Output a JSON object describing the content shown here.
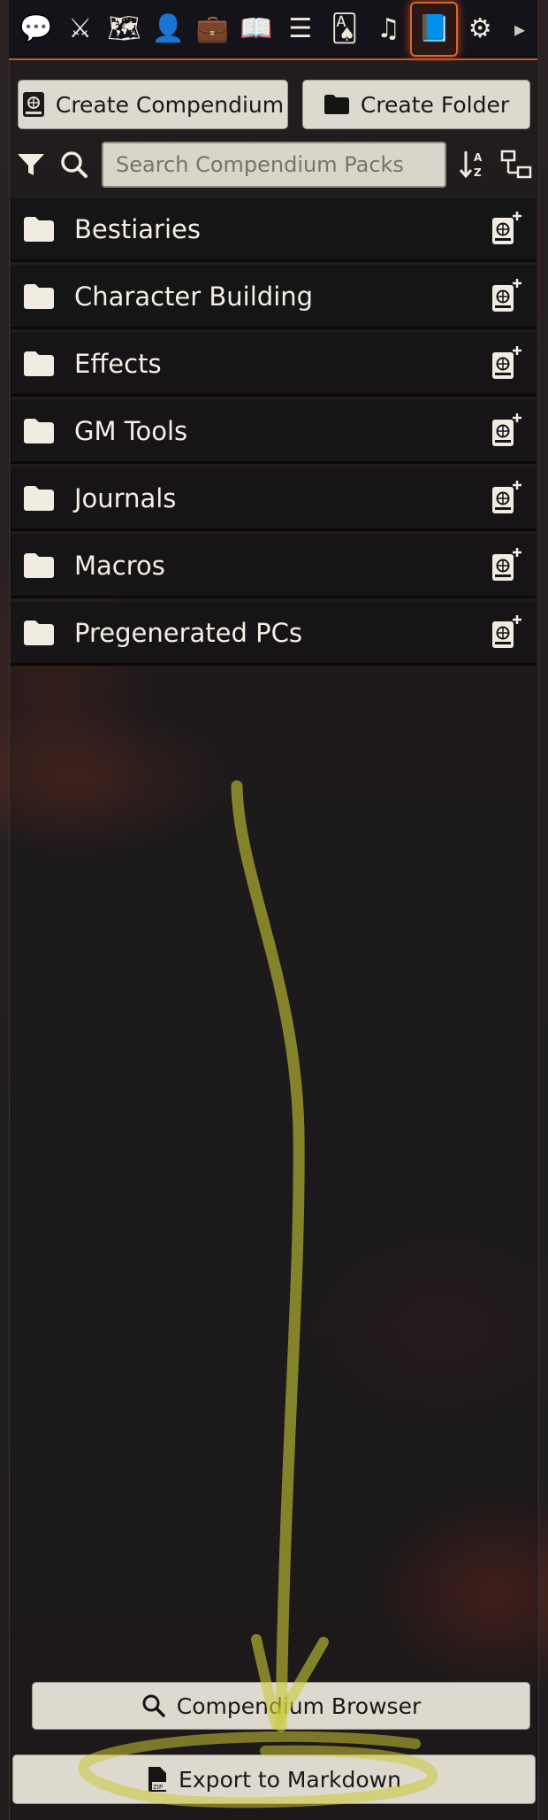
{
  "tabs": [
    {
      "name": "chat-icon",
      "glyph": "💬"
    },
    {
      "name": "combat-icon",
      "glyph": "⚔"
    },
    {
      "name": "scenes-map-icon",
      "glyph": "🗺"
    },
    {
      "name": "actors-user-icon",
      "glyph": "👤"
    },
    {
      "name": "items-suitcase-icon",
      "glyph": "💼"
    },
    {
      "name": "journal-book-icon",
      "glyph": "📖"
    },
    {
      "name": "tables-list-icon",
      "glyph": "☰"
    },
    {
      "name": "cards-icon",
      "glyph": "🂡"
    },
    {
      "name": "playlists-music-icon",
      "glyph": "♫"
    },
    {
      "name": "compendium-atlas-icon",
      "glyph": "📘",
      "active": true
    },
    {
      "name": "settings-cogs-icon",
      "glyph": "⚙"
    },
    {
      "name": "collapse-chevron-icon",
      "glyph": "▸"
    }
  ],
  "actions": {
    "create_compendium": "Create Compendium",
    "create_folder": "Create Folder"
  },
  "search": {
    "placeholder": "Search Compendium Packs"
  },
  "folders": [
    {
      "label": "Bestiaries"
    },
    {
      "label": "Character Building"
    },
    {
      "label": "Effects"
    },
    {
      "label": "GM Tools"
    },
    {
      "label": "Journals"
    },
    {
      "label": "Macros"
    },
    {
      "label": "Pregenerated PCs"
    }
  ],
  "footer": {
    "compendium_browser": "Compendium Browser",
    "export_markdown": "Export to Markdown"
  },
  "annotation_color": "#d4d23a"
}
